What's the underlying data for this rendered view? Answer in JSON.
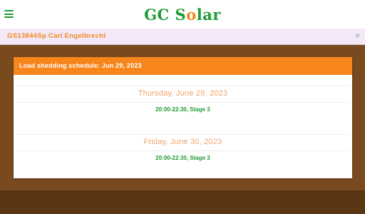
{
  "header": {
    "brand_part1": "GC S",
    "brand_part2": "o",
    "brand_part3": "lar",
    "menu_icon": "hamburger-menu-icon",
    "accent_green": "#1f9a35",
    "accent_orange": "#f08a1e"
  },
  "account": {
    "name": "GS13844Sp Carl Engelbrecht",
    "close_icon": "close-icon"
  },
  "schedule": {
    "header_title": "Load shedding schedule: Jun 29, 2023",
    "days": [
      {
        "date": "Thursday, June 29, 2023",
        "slot": "20:00-22:30, Stage 3"
      },
      {
        "date": "Friday, June 30, 2023",
        "slot": "20:00-22:30, Stage 3"
      }
    ]
  }
}
